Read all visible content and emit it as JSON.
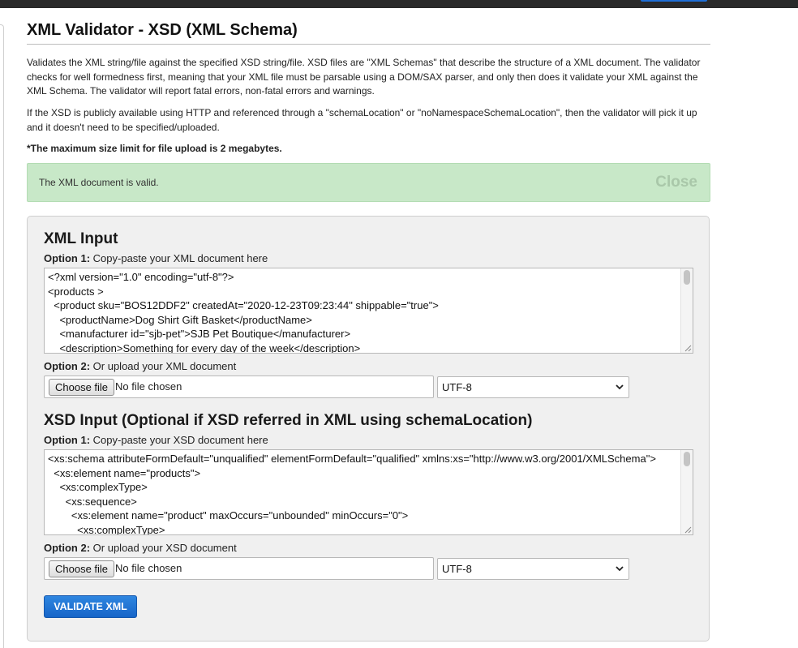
{
  "page": {
    "title": "XML Validator - XSD (XML Schema)",
    "description_1": "Validates the XML string/file against the specified XSD string/file. XSD files are \"XML Schemas\" that describe the structure of a XML document. The validator checks for well formedness first, meaning that your XML file must be parsable using a DOM/SAX parser, and only then does it validate your XML against the XML Schema. The validator will report fatal errors, non-fatal errors and warnings.",
    "description_2": "If the XSD is publicly available using HTTP and referenced through a \"schemaLocation\" or \"noNamespaceSchemaLocation\", then the validator will pick it up and it doesn't need to be specified/uploaded.",
    "size_note": "*The maximum size limit for file upload is 2 megabytes."
  },
  "alert": {
    "message": "The XML document is valid.",
    "close_label": "Close",
    "color": "#c8e8c8"
  },
  "xml_input": {
    "title": "XML Input",
    "option1_prefix": "Option 1:",
    "option1_text": "Copy-paste your XML document here",
    "lines": [
      "<?xml version=\"1.0\" encoding=\"utf-8\"?>",
      "<products >",
      "  <product sku=\"BOS12DDF2\" createdAt=\"2020-12-23T09:23:44\" shippable=\"true\">",
      "    <productName>Dog Shirt Gift Basket</productName>",
      "    <manufacturer id=\"sjb-pet\">SJB Pet Boutique</manufacturer>",
      "    <description>Something for every day of the week</description>"
    ],
    "option2_prefix": "Option 2:",
    "option2_text": "Or upload your XML document",
    "choose_file_label": "Choose file",
    "file_status": "No file chosen",
    "encoding": "UTF-8"
  },
  "xsd_input": {
    "title": "XSD Input (Optional if XSD referred in XML using schemaLocation)",
    "option1_prefix": "Option 1:",
    "option1_text": "Copy-paste your XSD document here",
    "lines": [
      "<xs:schema attributeFormDefault=\"unqualified\" elementFormDefault=\"qualified\" xmlns:xs=\"http://www.w3.org/2001/XMLSchema\">",
      "  <xs:element name=\"products\">",
      "    <xs:complexType>",
      "      <xs:sequence>",
      "        <xs:element name=\"product\" maxOccurs=\"unbounded\" minOccurs=\"0\">",
      "          <xs:complexType>"
    ],
    "option2_prefix": "Option 2:",
    "option2_text": "Or upload your XSD document",
    "choose_file_label": "Choose file",
    "file_status": "No file chosen",
    "encoding": "UTF-8"
  },
  "actions": {
    "validate_label": "VALIDATE XML",
    "accent": "#1f6fd6"
  }
}
